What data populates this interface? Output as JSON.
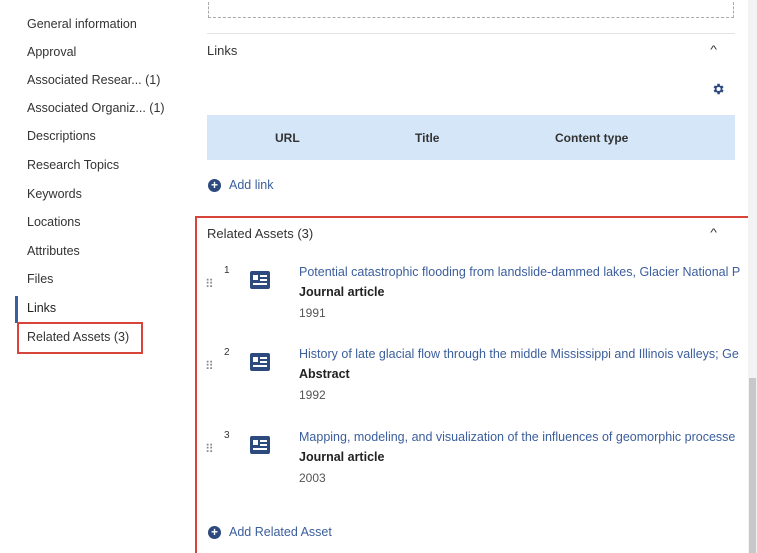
{
  "sidebar": {
    "items": [
      {
        "label": "General information"
      },
      {
        "label": "Approval"
      },
      {
        "label": "Associated Resear... (1)"
      },
      {
        "label": "Associated Organiz... (1)"
      },
      {
        "label": "Descriptions"
      },
      {
        "label": "Research Topics"
      },
      {
        "label": "Keywords"
      },
      {
        "label": "Locations"
      },
      {
        "label": "Attributes"
      },
      {
        "label": "Files"
      },
      {
        "label": "Links"
      },
      {
        "label": "Related Assets (3)"
      }
    ],
    "active": "Links"
  },
  "links_section": {
    "title": "Links",
    "columns": [
      "URL",
      "Title",
      "Content type"
    ],
    "add_label": "Add link"
  },
  "related_section": {
    "title": "Related Assets (3)",
    "assets": [
      {
        "index": "1",
        "title": "Potential catastrophic flooding from landslide-dammed lakes, Glacier National P",
        "type": "Journal article",
        "year": "1991",
        "icon": "document-icon"
      },
      {
        "index": "2",
        "title": "History of late glacial flow through the middle Mississippi and Illinois valleys; Ge",
        "type": "Abstract",
        "year": "1992",
        "icon": "document-icon"
      },
      {
        "index": "3",
        "title": "Mapping, modeling, and visualization of the influences of geomorphic processe",
        "type": "Journal article",
        "year": "2003",
        "icon": "document-icon"
      }
    ],
    "add_label": "Add Related Asset"
  },
  "colors": {
    "accent": "#3b5e9c",
    "icon_dark": "#2d4a7e",
    "table_header": "#d4e6f7",
    "highlight": "#d9443a"
  }
}
